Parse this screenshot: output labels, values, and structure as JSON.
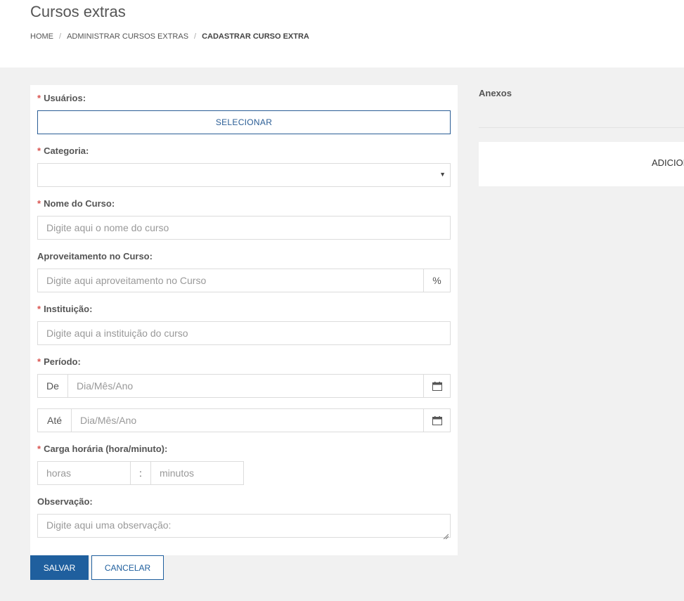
{
  "header": {
    "title": "Cursos extras",
    "breadcrumb": [
      "HOME",
      "ADMINISTRAR CURSOS EXTRAS",
      "CADASTRAR CURSO EXTRA"
    ],
    "separator": "/"
  },
  "form": {
    "required_mark": "*",
    "usuarios": {
      "label": "Usuários:",
      "button": "SELECIONAR"
    },
    "categoria": {
      "label": "Categoria:",
      "value": ""
    },
    "nome": {
      "label": "Nome do Curso:",
      "placeholder": "Digite aqui o nome do curso"
    },
    "aproveitamento": {
      "label": "Aproveitamento no Curso:",
      "placeholder": "Digite aqui aproveitamento no Curso",
      "suffix": "%"
    },
    "instituicao": {
      "label": "Instituição:",
      "placeholder": "Digite aqui a instituição do curso"
    },
    "periodo": {
      "label": "Período:",
      "from_label": "De",
      "to_label": "Até",
      "placeholder": "Dia/Mês/Ano"
    },
    "carga": {
      "label": "Carga horária (hora/minuto):",
      "hours_placeholder": "horas",
      "separator": ":",
      "minutes_placeholder": "minutos"
    },
    "observacao": {
      "label": "Observação:",
      "placeholder": "Digite aqui uma observação:"
    }
  },
  "actions": {
    "save": "SALVAR",
    "cancel": "CANCELAR"
  },
  "attachments": {
    "title": "Anexos",
    "add_button": "ADICIONAR"
  },
  "colors": {
    "primary": "#1f5f9e",
    "required": "#d9534f",
    "background": "#f1f1f1"
  },
  "icons": {
    "calendar": "calendar-icon",
    "select_caret": "chevron-down-icon",
    "resize": "resize-handle-icon"
  }
}
